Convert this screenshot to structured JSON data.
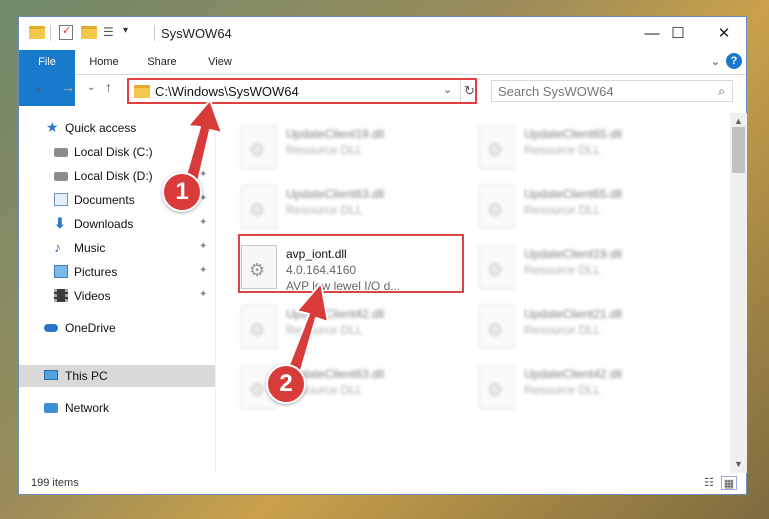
{
  "window": {
    "title": "SysWOW64",
    "minimize": "—",
    "maximize": "☐",
    "close": "✕"
  },
  "ribbon": {
    "tabs": [
      "File",
      "Home",
      "Share",
      "View"
    ],
    "expand_chevron": "⌄",
    "help": "?"
  },
  "address": {
    "path": "C:\\Windows\\SysWOW64",
    "dropdown": "⌄",
    "refresh": "↻"
  },
  "search": {
    "placeholder": "Search SysWOW64",
    "icon": "⌕"
  },
  "nav_buttons": {
    "back": "←",
    "forward": "→",
    "recent": "⌄",
    "up": "↑"
  },
  "sidebar": {
    "items": [
      {
        "label": "Quick access",
        "icon": "star-icon"
      },
      {
        "label": "Local Disk (C:)",
        "icon": "disk-icon",
        "pinned": true
      },
      {
        "label": "Local Disk (D:)",
        "icon": "disk-icon",
        "pinned": true
      },
      {
        "label": "Documents",
        "icon": "documents-icon",
        "pinned": true
      },
      {
        "label": "Downloads",
        "icon": "downloads-icon",
        "pinned": true
      },
      {
        "label": "Music",
        "icon": "music-icon",
        "pinned": true
      },
      {
        "label": "Pictures",
        "icon": "pictures-icon",
        "pinned": true
      },
      {
        "label": "Videos",
        "icon": "videos-icon",
        "pinned": true
      },
      {
        "label": "OneDrive",
        "icon": "onedrive-icon"
      },
      {
        "label": "This PC",
        "icon": "this-pc-icon",
        "selected": true
      },
      {
        "label": "Network",
        "icon": "network-icon"
      }
    ],
    "pin_glyph": "📌"
  },
  "files": [
    {
      "name": "UpdateClient19.dll",
      "desc": "Resource DLL",
      "blurred": true
    },
    {
      "name": "UpdateClient65.dll",
      "desc": "Resource DLL",
      "blurred": true
    },
    {
      "name": "UpdateClient63.dll",
      "desc": "Resource DLL",
      "blurred": true
    },
    {
      "name": "UpdateClient65.dll",
      "desc": "Resource DLL",
      "blurred": true
    },
    {
      "name": "avp_iont.dll",
      "version": "4.0.164.4160",
      "desc": "AVP low lewel I/O d...",
      "blurred": false
    },
    {
      "name": "UpdateClient19.dll",
      "desc": "Resource DLL",
      "blurred": true
    },
    {
      "name": "UpdateClient42.dll",
      "desc": "Resource DLL",
      "blurred": true
    },
    {
      "name": "UpdateClient21.dll",
      "desc": "Resource DLL",
      "blurred": true
    },
    {
      "name": "UpdateClient63.dll",
      "desc": "Resource DLL",
      "blurred": true
    },
    {
      "name": "UpdateClient42.dll",
      "desc": "Resource DLL",
      "blurred": true
    }
  ],
  "status": {
    "item_count": "199 items"
  },
  "annotations": {
    "badge1": "1",
    "badge2": "2",
    "color": "#d93a3a"
  },
  "colors": {
    "file_tab": "#1979ca",
    "selected_nav": "#d9d9d9",
    "highlight": "#d94545"
  }
}
